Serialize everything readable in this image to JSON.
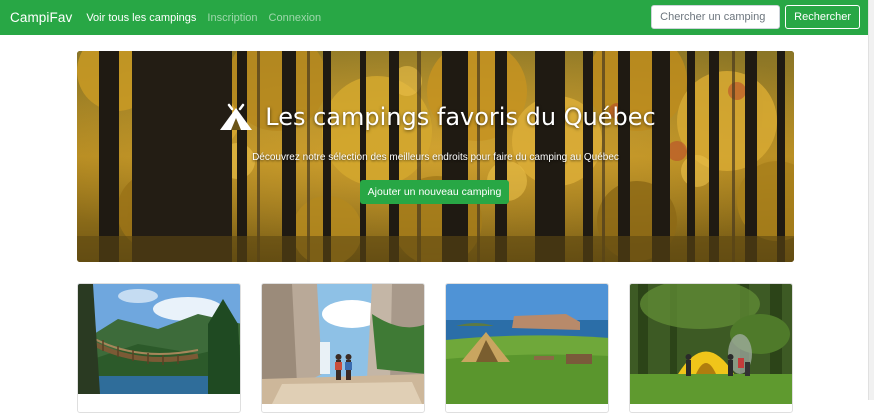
{
  "navbar": {
    "brand": "CampiFav",
    "links": [
      {
        "label": "Voir tous les campings",
        "active": true
      },
      {
        "label": "Inscription",
        "active": false
      },
      {
        "label": "Connexion",
        "active": false
      }
    ],
    "search": {
      "placeholder": "Chercher un camping",
      "button_label": "Rechercher"
    }
  },
  "hero": {
    "icon": "tent-icon",
    "title": "Les campings favoris du Québec",
    "subtitle": "Découvrez notre sélection des meilleurs endroits pour faire du camping au Québec",
    "button_label": "Ajouter un nouveau camping"
  },
  "cards": [
    {
      "image": "suspension-bridge-photo"
    },
    {
      "image": "canyon-waterfall-hikers-photo"
    },
    {
      "image": "perce-rock-campsite-photo"
    },
    {
      "image": "forest-tent-campers-photo"
    }
  ],
  "colors": {
    "brand_green": "#28a745",
    "white": "#ffffff"
  }
}
